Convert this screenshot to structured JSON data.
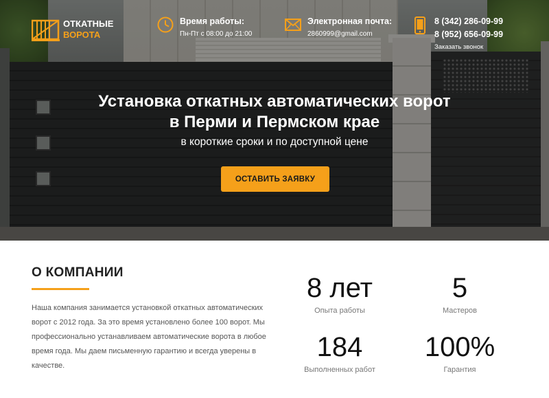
{
  "header": {
    "logo": {
      "line1": "ОТКАТНЫЕ",
      "line2": "ВОРОТА"
    },
    "work_hours": {
      "title": "Время работы:",
      "value": "Пн-Пт с 08:00 до 21:00",
      "icon": "clock-icon"
    },
    "email": {
      "title": "Электронная почта:",
      "value": "2860999@gmail.com",
      "icon": "envelope-icon"
    },
    "contacts": {
      "phone1": "8 (342) 286-09-99",
      "phone2": "8 (952) 656-09-99",
      "callback": "Заказать звонок",
      "icon": "phone-icon"
    }
  },
  "hero": {
    "title_line1": "Установка откатных автоматических ворот",
    "title_line2": "в Перми и Пермском крае",
    "subtitle": "в короткие сроки и по доступной цене",
    "cta": "ОСТАВИТЬ ЗАЯВКУ"
  },
  "about": {
    "title": "О КОМПАНИИ",
    "text": "Наша компания занимается установкой откатных автоматических ворот с 2012 года. За это время установлено более 100 ворот. Мы профессионально устанавливаем автоматические ворота в любое время года. Мы даем письменную гарантию и всегда уверены в качестве."
  },
  "stats": [
    {
      "value": "8 лет",
      "label": "Опыта работы"
    },
    {
      "value": "5",
      "label": "Мастеров"
    },
    {
      "value": "184",
      "label": "Выполненных работ"
    },
    {
      "value": "100%",
      "label": "Гарантия"
    }
  ],
  "colors": {
    "accent": "#f5a01a"
  }
}
